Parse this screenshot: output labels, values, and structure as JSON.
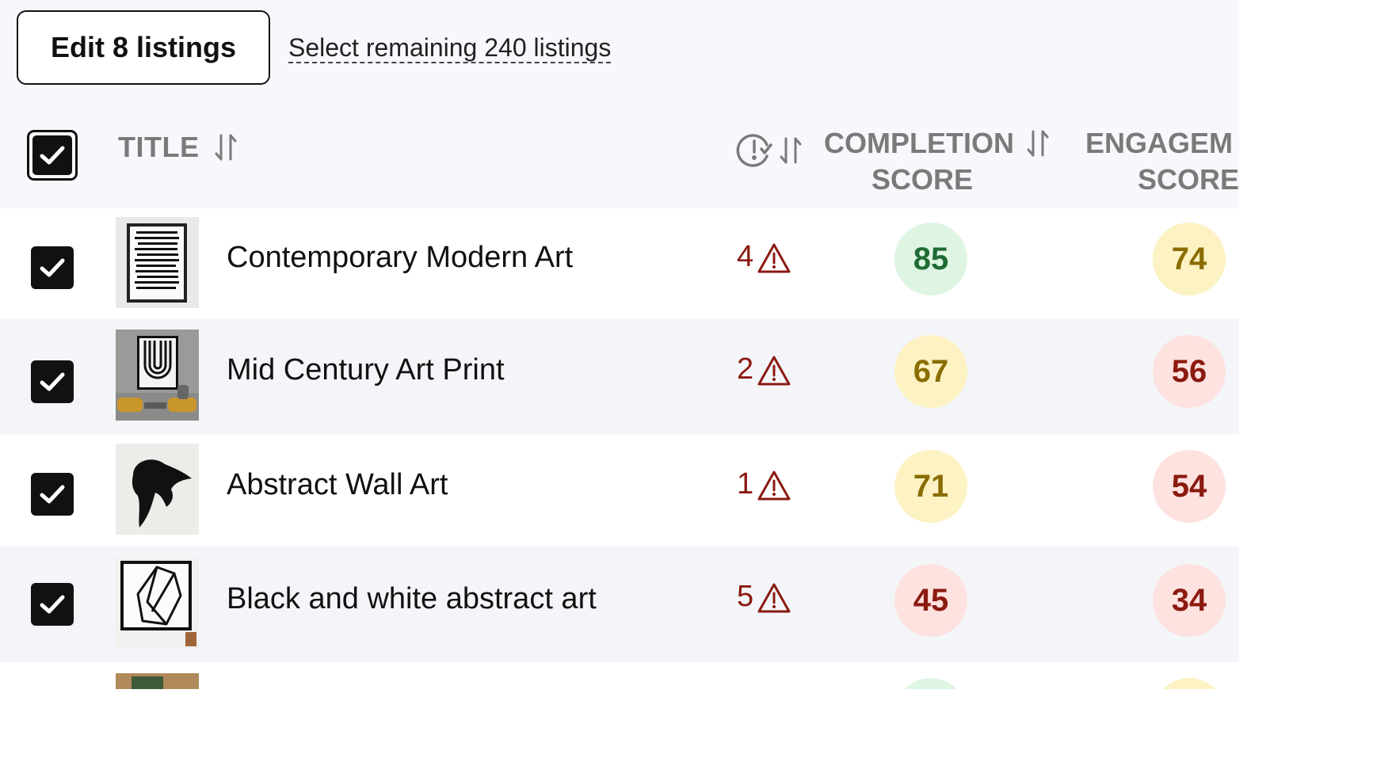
{
  "toolbar": {
    "edit_button_label": "Edit 8 listings",
    "select_remaining_label": "Select remaining 240 listings"
  },
  "table": {
    "header": {
      "title": "TITLE",
      "completion_line1": "COMPLETION",
      "completion_line2": "SCORE",
      "engagement_line1": "ENGAGEM",
      "engagement_line2": "SCORE"
    },
    "rows": [
      {
        "title": "Contemporary Modern Art",
        "issues": "4",
        "completion": "85",
        "completion_color": "green",
        "engagement": "74",
        "engagement_color": "yellow"
      },
      {
        "title": "Mid Century Art Print",
        "issues": "2",
        "completion": "67",
        "completion_color": "yellow",
        "engagement": "56",
        "engagement_color": "red"
      },
      {
        "title": "Abstract Wall Art",
        "issues": "1",
        "completion": "71",
        "completion_color": "yellow",
        "engagement": "54",
        "engagement_color": "red"
      },
      {
        "title": "Black and white abstract art",
        "issues": "5",
        "completion": "45",
        "completion_color": "red",
        "engagement": "34",
        "engagement_color": "red"
      }
    ]
  },
  "icons": {
    "checkbox": "check-icon",
    "sort": "sort-icon",
    "issues_header": "clock-check-icon",
    "warning": "warning-triangle-icon"
  },
  "colors": {
    "score_green_bg": "#dff5e3",
    "score_yellow_bg": "#fcf2c3",
    "score_red_bg": "#fde2df",
    "issue_red": "#8b1a10"
  }
}
